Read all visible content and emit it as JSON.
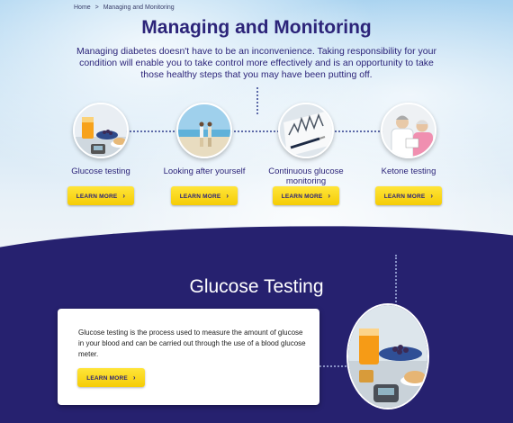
{
  "breadcrumb": {
    "home": "Home",
    "sep": ">",
    "current": "Managing and Monitoring"
  },
  "page": {
    "title": "Managing and Monitoring",
    "intro": "Managing diabetes doesn't have to be an inconvenience. Taking responsibility for your condition will enable you to take control more effectively and is an opportunity to take those healthy steps that you may have been putting off."
  },
  "items": [
    {
      "label": "Glucose testing",
      "button": "LEARN MORE",
      "icon": "breakfast-image"
    },
    {
      "label": "Looking after yourself",
      "button": "LEARN MORE",
      "icon": "beach-couple-image"
    },
    {
      "label": "Continuous glucose monitoring",
      "button": "LEARN MORE",
      "icon": "glucose-graph-image"
    },
    {
      "label": "Ketone testing",
      "button": "LEARN MORE",
      "icon": "doctor-patient-image"
    }
  ],
  "section": {
    "title": "Glucose Testing",
    "body": "Glucose testing is the process used to measure the amount of glucose in your blood and can be carried out through the use of a blood glucose meter.",
    "button": "LEARN MORE",
    "icon": "breakfast-meter-image"
  },
  "chevron": "›",
  "colors": {
    "brand": "#2c2479",
    "purple_bg": "#26216f",
    "button": "#f5cc05"
  }
}
